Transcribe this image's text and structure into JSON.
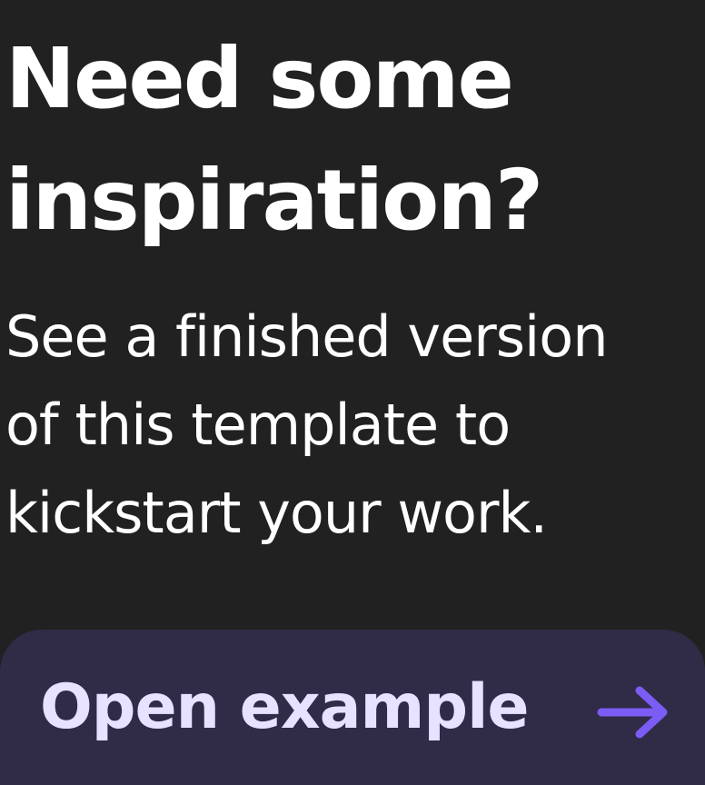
{
  "card": {
    "title": "Need some inspiration?",
    "description_lines": [
      "See a finished version",
      "of this template to",
      "kickstart your work."
    ],
    "button_label": "Open example",
    "button_icon": "arrow-right-icon"
  },
  "colors": {
    "background": "#212121",
    "text": "#ffffff",
    "button_background": "#302b47",
    "button_text": "#e6e2ff",
    "accent": "#7b5cf5"
  }
}
